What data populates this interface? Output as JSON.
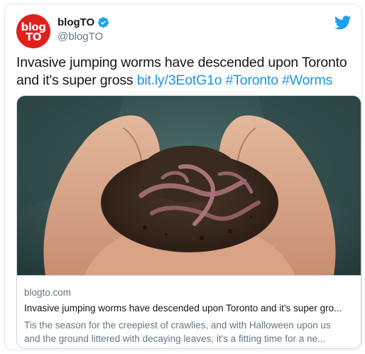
{
  "account": {
    "avatar_line1": "blog",
    "avatar_line2": "TO",
    "display_name": "blogTO",
    "handle": "@blogTO",
    "verified": true
  },
  "tweet": {
    "text": "Invasive jumping worms have descended upon Toronto and it's super gross",
    "link": "bit.ly/3EotG1o",
    "hashtags": [
      "#Toronto",
      "#Worms"
    ]
  },
  "card": {
    "domain": "blogto.com",
    "title": "Invasive jumping worms have descended upon Toronto and it's super gro...",
    "description_line1": "Tis the season for the creepiest of crawlies, and with Halloween upon us",
    "description_line2": "and the ground littered with decaying leaves, it's a fitting time for a ne..."
  },
  "colors": {
    "brand_red": "#e0201c",
    "twitter_blue": "#1da1f2",
    "link_blue": "#1b95e0"
  },
  "icons": [
    "verified-badge-icon",
    "twitter-bird-icon"
  ]
}
